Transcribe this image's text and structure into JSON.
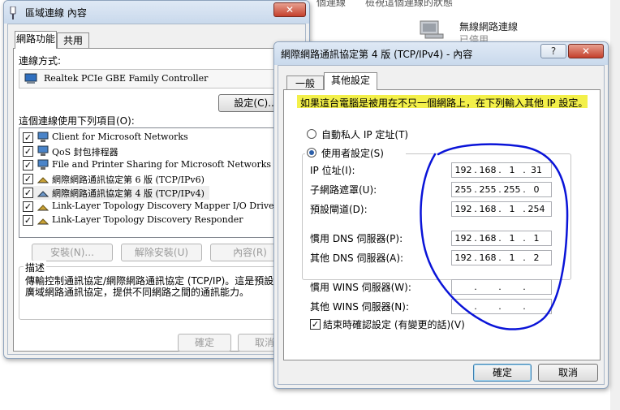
{
  "background": {
    "text_fragments": [
      "個連線",
      "檢視這個連線的狀態"
    ],
    "wifi_label": "無線網路連線",
    "wifi_status": "已停用"
  },
  "left_dialog": {
    "title": "區域連線 內容",
    "close_glyph": "✕",
    "tabs": [
      "網路功能",
      "共用"
    ],
    "connect_using_label": "連線方式:",
    "adapter_name": "Realtek PCIe GBE Family Controller",
    "configure_button": "設定(C)...",
    "items_label": "這個連線使用下列項目(O):",
    "items": [
      {
        "checked": true,
        "text": "Client for Microsoft Networks"
      },
      {
        "checked": true,
        "text": "QoS 封包排程器"
      },
      {
        "checked": true,
        "text": "File and Printer Sharing for Microsoft Networks"
      },
      {
        "checked": true,
        "text": "網際網路通訊協定第 6 版 (TCP/IPv6)"
      },
      {
        "checked": true,
        "text": "網際網路通訊協定第 4 版 (TCP/IPv4)"
      },
      {
        "checked": true,
        "text": "Link-Layer Topology Discovery Mapper I/O Driver"
      },
      {
        "checked": true,
        "text": "Link-Layer Topology Discovery Responder"
      }
    ],
    "install_button": "安裝(N)...",
    "uninstall_button": "解除安裝(U)",
    "properties_button": "內容(R)",
    "description_label": "描述",
    "description_text": "傳輸控制通訊協定/網際網路通訊協定 (TCP/IP)。這是預設的廣域網路通訊協定，提供不同網路之間的通訊能力。",
    "ok_button": "確定",
    "cancel_button": "取消"
  },
  "right_dialog": {
    "title": "網際網路通訊協定第 4 版 (TCP/IPv4) - 內容",
    "help_glyph": "?",
    "close_glyph": "✕",
    "tabs": [
      "一般",
      "其他設定"
    ],
    "info_text": "如果這台電腦是被用在不只一個網路上，在下列輸入其他 IP 設定。",
    "radio_auto": "自動私人 IP 定址(T)",
    "radio_user": "使用者設定(S)",
    "ip_label": "IP 位址(I):",
    "ip_value": [
      "192",
      "168",
      "1",
      "31"
    ],
    "subnet_label": "子網路遮罩(U):",
    "subnet_value": [
      "255",
      "255",
      "255",
      "0"
    ],
    "gateway_label": "預設閘道(D):",
    "gateway_value": [
      "192",
      "168",
      "1",
      "254"
    ],
    "dns1_label": "慣用 DNS 伺服器(P):",
    "dns1_value": [
      "192",
      "168",
      "1",
      "1"
    ],
    "dns2_label": "其他 DNS 伺服器(A):",
    "dns2_value": [
      "192",
      "168",
      "1",
      "2"
    ],
    "wins1_label": "慣用 WINS 伺服器(W):",
    "wins2_label": "其他 WINS 伺服器(N):",
    "validate_label": "結束時確認設定 (有變更的話)(V)",
    "ok_button": "確定",
    "cancel_button": "取消"
  }
}
